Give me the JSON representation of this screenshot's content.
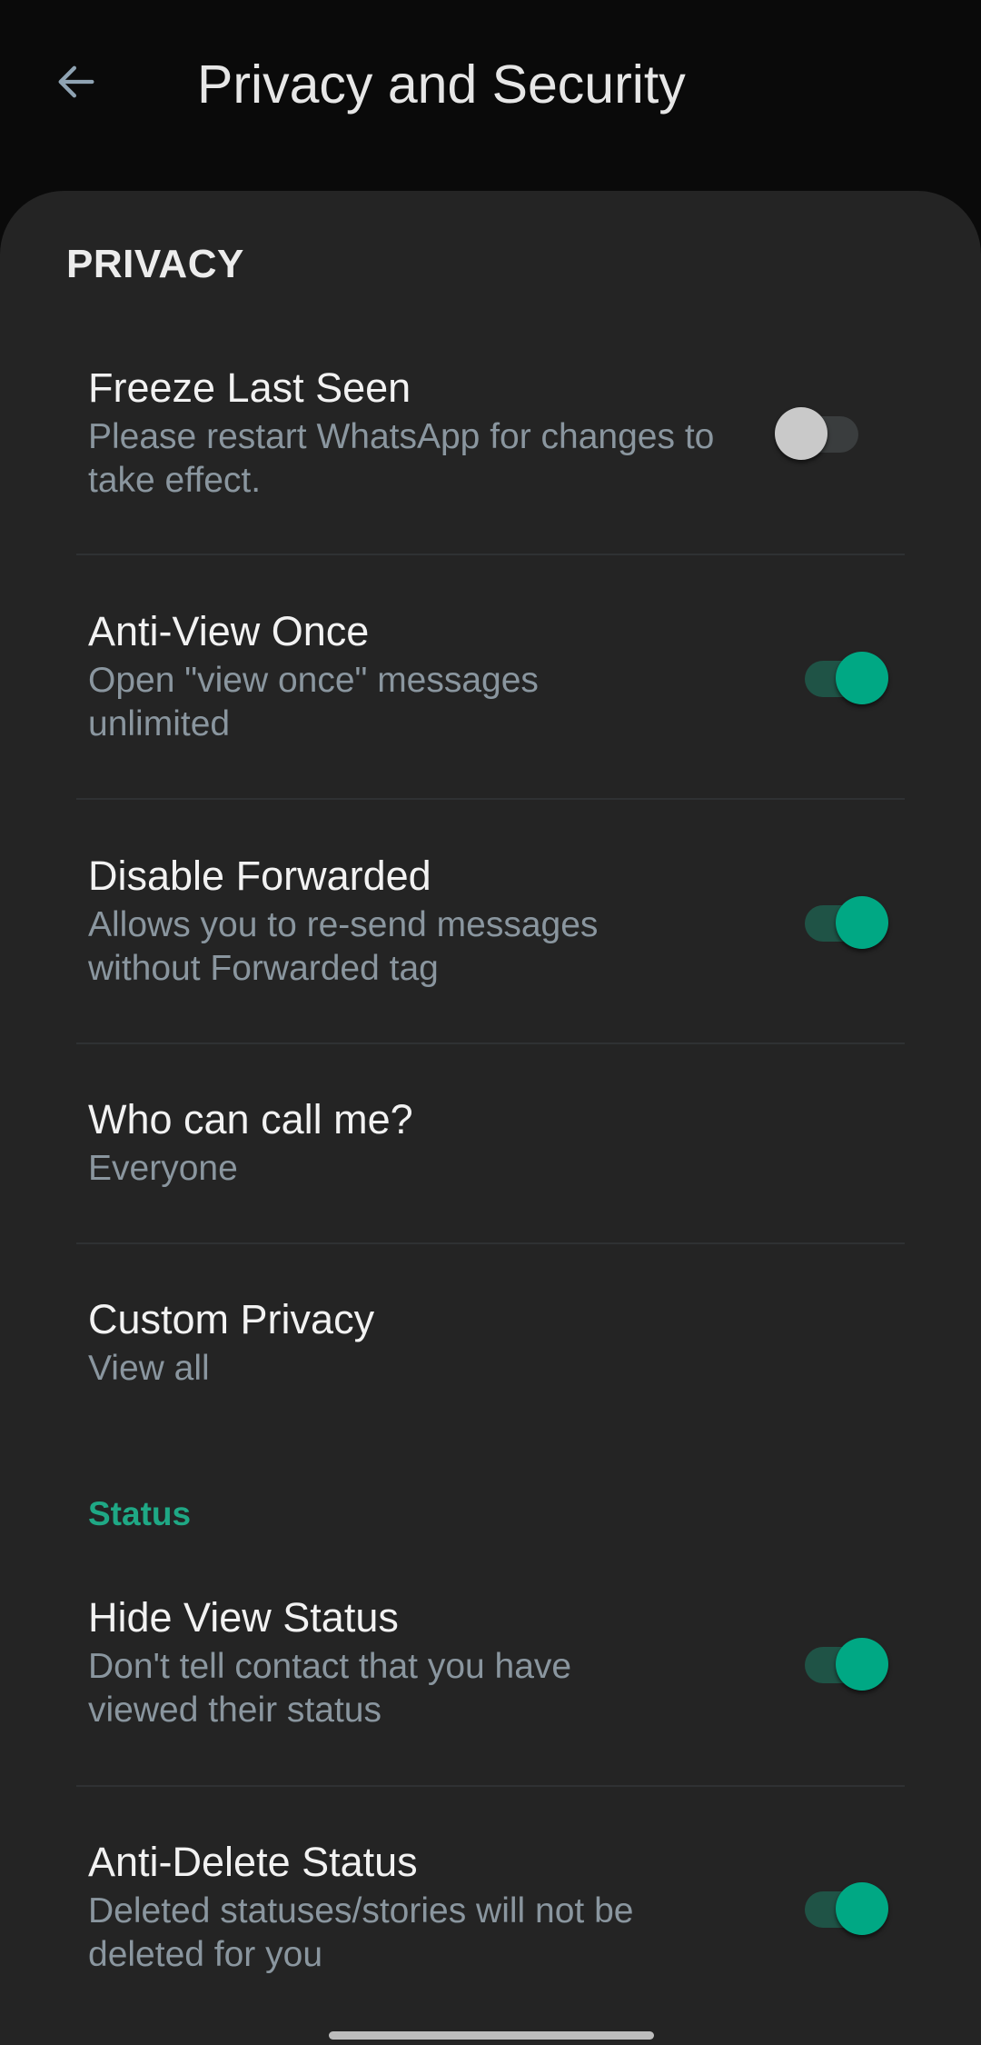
{
  "header": {
    "title": "Privacy and Security",
    "back_icon": "arrow-left-icon"
  },
  "colors": {
    "accent": "#00a884",
    "track_on": "#1f5346",
    "background": "#242424",
    "top_bar": "#0a0a0a",
    "subtitle": "#8a969f"
  },
  "privacy": {
    "section_label": "PRIVACY",
    "items": [
      {
        "title": "Freeze Last Seen",
        "subtitle": "Please restart WhatsApp for changes to take effect.",
        "toggle": false
      },
      {
        "title": "Anti-View Once",
        "subtitle": "Open \"view once\" messages unlimited",
        "toggle": true
      },
      {
        "title": "Disable Forwarded",
        "subtitle": "Allows you to re-send messages without Forwarded tag",
        "toggle": true
      },
      {
        "title": "Who can call me?",
        "subtitle": "Everyone"
      },
      {
        "title": "Custom Privacy",
        "subtitle": "View all"
      }
    ]
  },
  "status": {
    "section_label": "Status",
    "items": [
      {
        "title": "Hide View Status",
        "subtitle": "Don't tell contact that you have viewed their status",
        "toggle": true
      },
      {
        "title": "Anti-Delete Status",
        "subtitle": "Deleted statuses/stories will not be deleted for you",
        "toggle": true
      }
    ]
  }
}
